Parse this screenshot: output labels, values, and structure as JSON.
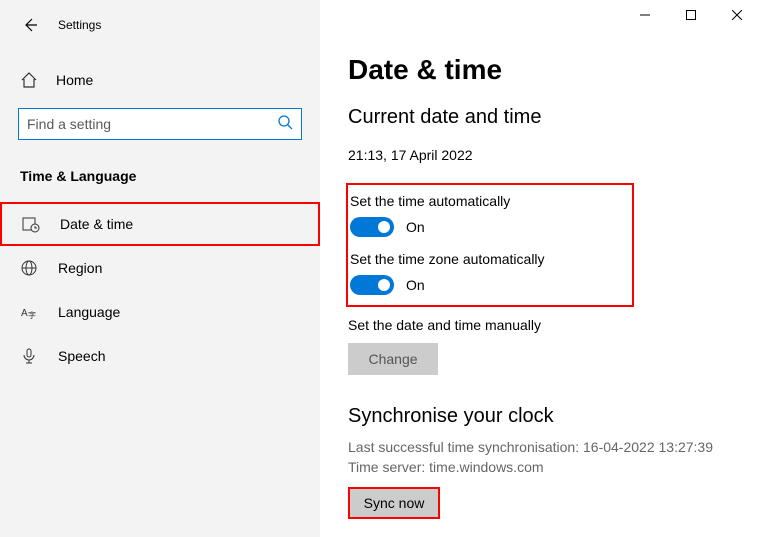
{
  "app_title": "Settings",
  "home_label": "Home",
  "search_placeholder": "Find a setting",
  "category": "Time & Language",
  "nav": {
    "datetime": "Date & time",
    "region": "Region",
    "language": "Language",
    "speech": "Speech"
  },
  "page": {
    "title": "Date & time",
    "section": "Current date and time",
    "current": "21:13, 17 April 2022",
    "auto_time_label": "Set the time automatically",
    "auto_time_state": "On",
    "auto_tz_label": "Set the time zone automatically",
    "auto_tz_state": "On",
    "manual_label": "Set the date and time manually",
    "change_btn": "Change",
    "sync_title": "Synchronise your clock",
    "sync_last": "Last successful time synchronisation: 16-04-2022 13:27:39",
    "sync_server": "Time server: time.windows.com",
    "sync_btn": "Sync now"
  }
}
